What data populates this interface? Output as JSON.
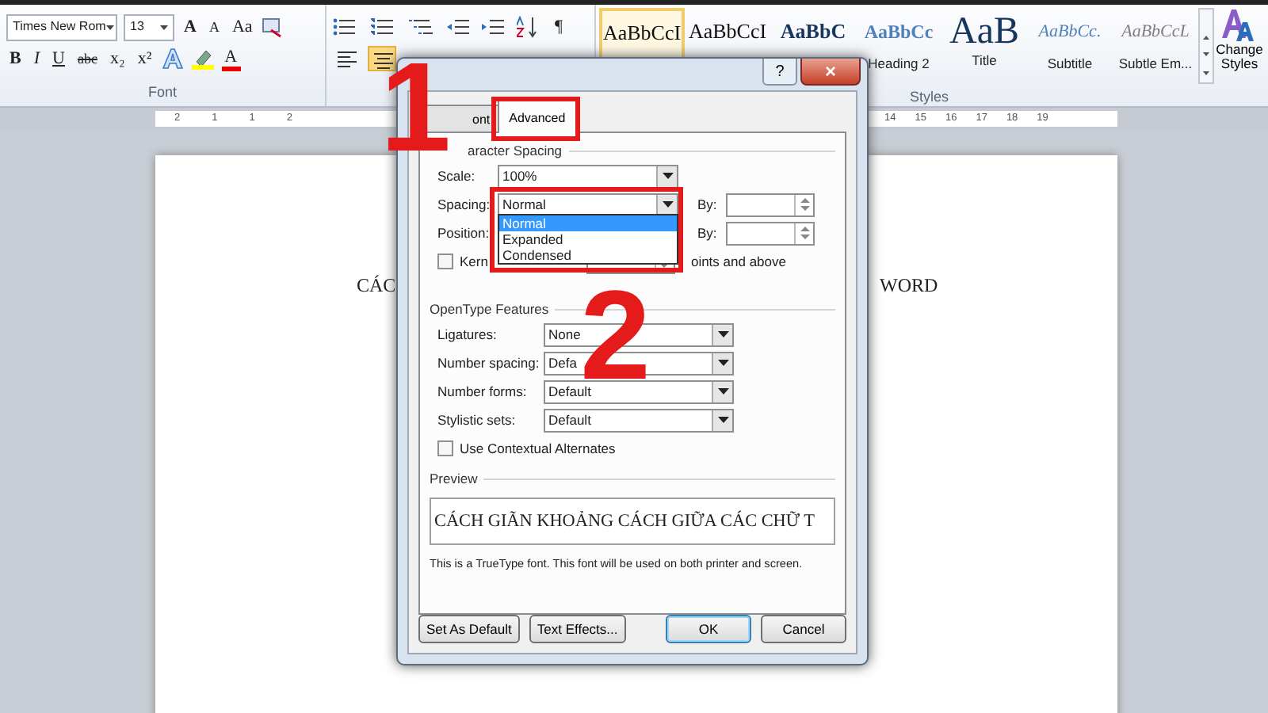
{
  "ribbon": {
    "font_group": {
      "font_name": "Times New Rom",
      "font_size": "13",
      "grow_label": "A",
      "shrink_label": "A",
      "change_case": "Aa",
      "format_buttons": [
        "B",
        "I",
        "U",
        "abc",
        "x₂",
        "x²"
      ],
      "font_color_label": "A",
      "label": "Font"
    },
    "paragraph_group": {
      "pilcrow": "¶",
      "align": [
        {
          "kind": "left",
          "selected": false
        },
        {
          "kind": "center",
          "selected": true
        }
      ]
    },
    "styles_group": {
      "styles": [
        {
          "sample": "AaBbCcI",
          "kind": "normal",
          "selected": true
        },
        {
          "sample": "AaBbCcI",
          "kind": "normal",
          "selected": false
        },
        {
          "sample": "AaBbC",
          "kind": "heading",
          "selected": false
        },
        {
          "sample": "AaBbCc",
          "kind": "heading2",
          "label": "Heading 2",
          "selected": false
        },
        {
          "sample": "AaB",
          "kind": "title",
          "label": "Title",
          "selected": false
        },
        {
          "sample": "AaBbCc.",
          "kind": "subtitle",
          "label": "Subtitle",
          "selected": false
        },
        {
          "sample": "AaBbCcL",
          "kind": "emphasis",
          "label": "Subtle Em...",
          "selected": false
        }
      ],
      "change_styles": "Change Styles",
      "label": "Styles"
    }
  },
  "ruler": {
    "left_marks": [
      "2",
      "1",
      "1",
      "2"
    ],
    "right_marks": [
      "14",
      "15",
      "16",
      "17",
      "18",
      "19"
    ]
  },
  "document": {
    "visible_text": [
      "CÁC",
      "WORD"
    ]
  },
  "dialog": {
    "help": "?",
    "close": "×",
    "tabs": [
      {
        "label": "ont",
        "selected": false
      },
      {
        "label": "Advanced",
        "selected": true
      }
    ],
    "character_spacing": {
      "heading": "aracter Spacing",
      "scale": {
        "label": "Scale:",
        "value": "100%"
      },
      "spacing": {
        "label": "Spacing:",
        "value": "Normal",
        "expanded": true,
        "options": [
          {
            "label": "Normal",
            "selected": true
          },
          {
            "label": "Expanded",
            "selected": false
          },
          {
            "label": "Condensed",
            "selected": false
          }
        ]
      },
      "spacing_by": {
        "label": "By:"
      },
      "position": {
        "label": "Position:"
      },
      "position_by": {
        "label": "By:"
      },
      "kerning": {
        "label": "Kern",
        "checked": false,
        "suffix": "oints and above"
      }
    },
    "opentype": {
      "heading": "OpenType Features",
      "fields": [
        {
          "label": "Ligatures:",
          "value": "None"
        },
        {
          "label": "Number spacing:",
          "value": "Defa"
        },
        {
          "label": "Number forms:",
          "value": "Default"
        },
        {
          "label": "Stylistic sets:",
          "value": "Default"
        }
      ],
      "contextual_alternates": {
        "label": "Use Contextual Alternates",
        "checked": false
      }
    },
    "preview": {
      "heading": "Preview",
      "sample": "CÁCH GIÃN KHOẢNG CÁCH GIỮA CÁC CHỮ T",
      "caption": "This is a TrueType font. This font will be used on both printer and screen."
    },
    "buttons": [
      {
        "label": "Set As Default",
        "kind": "plain"
      },
      {
        "label": "Text Effects...",
        "kind": "plain"
      },
      {
        "label": "OK",
        "kind": "default"
      },
      {
        "label": "Cancel",
        "kind": "plain"
      }
    ]
  },
  "annotations": [
    {
      "label": "1"
    },
    {
      "label": "2"
    }
  ]
}
